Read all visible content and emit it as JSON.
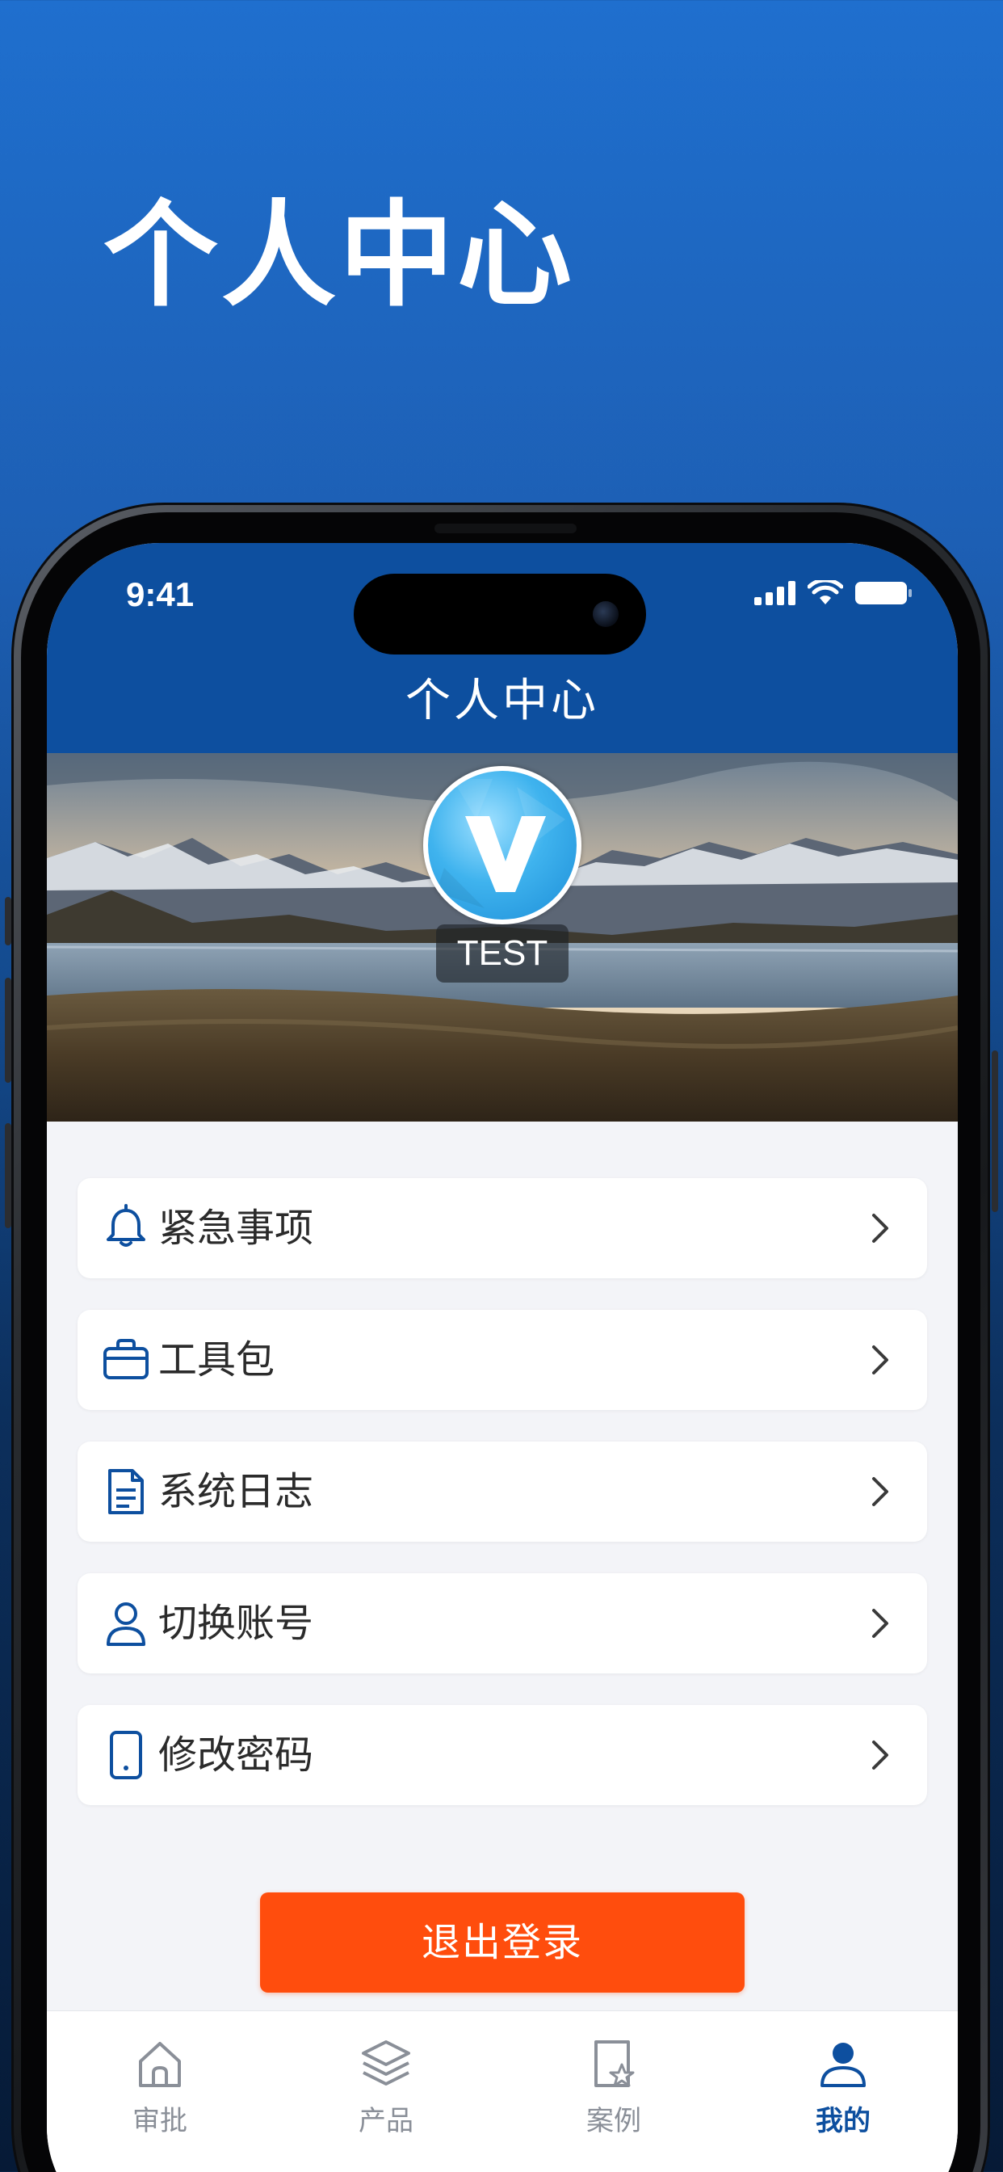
{
  "promo": {
    "headline": "个人中心"
  },
  "status_bar": {
    "time": "9:41"
  },
  "nav": {
    "title": "个人中心"
  },
  "profile": {
    "username": "TEST",
    "avatar_letter": "V"
  },
  "menu": {
    "items": [
      {
        "label": "紧急事项",
        "icon": "bell-icon"
      },
      {
        "label": "工具包",
        "icon": "briefcase-icon"
      },
      {
        "label": "系统日志",
        "icon": "document-icon"
      },
      {
        "label": "切换账号",
        "icon": "user-icon"
      },
      {
        "label": "修改密码",
        "icon": "phone-icon"
      }
    ]
  },
  "logout": {
    "label": "退出登录"
  },
  "tabbar": {
    "tabs": [
      {
        "label": "审批",
        "icon": "home-icon",
        "active": false
      },
      {
        "label": "产品",
        "icon": "layers-icon",
        "active": false
      },
      {
        "label": "案例",
        "icon": "bookmark-star-icon",
        "active": false
      },
      {
        "label": "我的",
        "icon": "person-icon",
        "active": true
      }
    ]
  },
  "colors": {
    "accent": "#0d4f9f",
    "logout": "#ff4d0d",
    "page_bg": "#f3f4f8"
  }
}
